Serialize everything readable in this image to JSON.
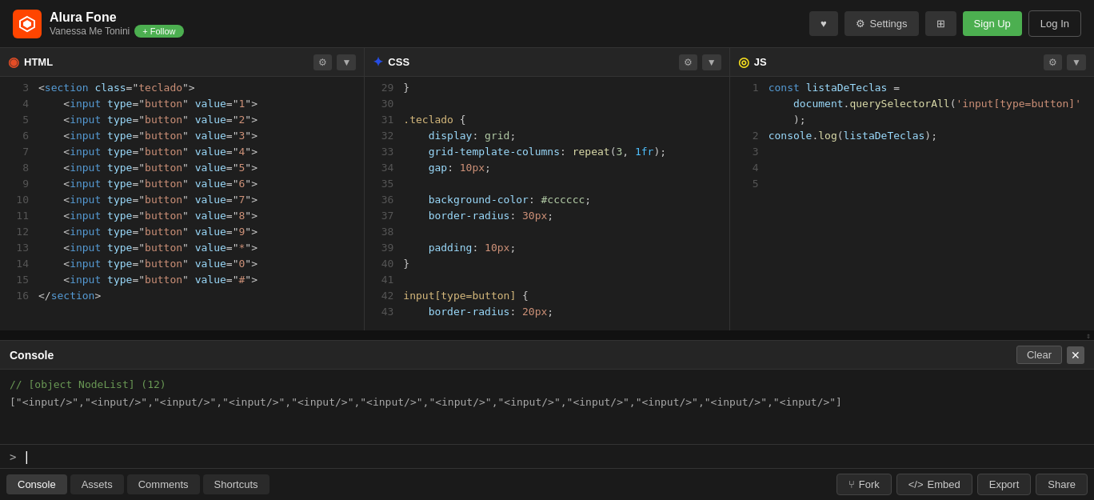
{
  "header": {
    "logo_symbol": "◈",
    "title": "Alura Fone",
    "subtitle": "Vanessa Me Tonini",
    "follow_label": "+ Follow",
    "heart_icon": "♥",
    "settings_icon": "⚙",
    "settings_label": "Settings",
    "grid_icon": "⊞",
    "signup_label": "Sign Up",
    "login_label": "Log In"
  },
  "editors": {
    "html": {
      "label": "HTML",
      "icon": "◉",
      "lines": [
        {
          "num": "3",
          "code": "<section class=\"teclado\">"
        },
        {
          "num": "4",
          "code": "    <input type=\"button\" value=\"1\">"
        },
        {
          "num": "5",
          "code": "    <input type=\"button\" value=\"2\">"
        },
        {
          "num": "6",
          "code": "    <input type=\"button\" value=\"3\">"
        },
        {
          "num": "7",
          "code": "    <input type=\"button\" value=\"4\">"
        },
        {
          "num": "8",
          "code": "    <input type=\"button\" value=\"5\">"
        },
        {
          "num": "9",
          "code": "    <input type=\"button\" value=\"6\">"
        },
        {
          "num": "10",
          "code": "    <input type=\"button\" value=\"7\">"
        },
        {
          "num": "11",
          "code": "    <input type=\"button\" value=\"8\">"
        },
        {
          "num": "12",
          "code": "    <input type=\"button\" value=\"9\">"
        },
        {
          "num": "13",
          "code": "    <input type=\"button\" value=\"*\">"
        },
        {
          "num": "14",
          "code": "    <input type=\"button\" value=\"0\">"
        },
        {
          "num": "15",
          "code": "    <input type=\"button\" value=\"#\">"
        },
        {
          "num": "16",
          "code": "</section>"
        }
      ]
    },
    "css": {
      "label": "CSS",
      "icon": "✦",
      "lines": [
        {
          "num": "29",
          "code": "}"
        },
        {
          "num": "30",
          "code": ""
        },
        {
          "num": "31",
          "code": ".teclado {"
        },
        {
          "num": "32",
          "code": "    display: grid;"
        },
        {
          "num": "33",
          "code": "    grid-template-columns: repeat(3, 1fr);"
        },
        {
          "num": "34",
          "code": "    gap: 10px;"
        },
        {
          "num": "35",
          "code": ""
        },
        {
          "num": "36",
          "code": "    background-color: #cccccc;"
        },
        {
          "num": "37",
          "code": "    border-radius: 30px;"
        },
        {
          "num": "38",
          "code": ""
        },
        {
          "num": "39",
          "code": "    padding: 10px;"
        },
        {
          "num": "40",
          "code": "}"
        },
        {
          "num": "41",
          "code": ""
        },
        {
          "num": "42",
          "code": "input[type=button] {"
        },
        {
          "num": "43",
          "code": "    border-radius: 20px;"
        }
      ]
    },
    "js": {
      "label": "JS",
      "icon": "◎",
      "lines": [
        {
          "num": "1",
          "code_parts": [
            {
              "text": "const ",
              "cls": "kw"
            },
            {
              "text": "listaDeTeclas",
              "cls": "prop"
            },
            {
              "text": " =",
              "cls": "punc"
            }
          ]
        },
        {
          "num": "",
          "code_parts": [
            {
              "text": "    document",
              "cls": "prop"
            },
            {
              "text": ".",
              "cls": "punc"
            },
            {
              "text": "querySelectorAll",
              "cls": "fn"
            },
            {
              "text": "('input[type=button]'",
              "cls": "str"
            }
          ]
        },
        {
          "num": "",
          "code_parts": [
            {
              "text": "    );",
              "cls": "punc"
            }
          ]
        },
        {
          "num": "2",
          "code_parts": [
            {
              "text": "console",
              "cls": "prop"
            },
            {
              "text": ".",
              "cls": "punc"
            },
            {
              "text": "log",
              "cls": "fn"
            },
            {
              "text": "(listaDeTeclas);",
              "cls": "punc"
            }
          ]
        },
        {
          "num": "3",
          "code_parts": []
        },
        {
          "num": "4",
          "code_parts": []
        },
        {
          "num": "5",
          "code_parts": []
        }
      ]
    }
  },
  "console": {
    "title": "Console",
    "clear_label": "Clear",
    "close_icon": "✕",
    "output": [
      "// [object NodeList] (12)",
      "[\"<input/>\",\"<input/>\",\"<input/>\",\"<input/>\",\"<input/>\",\"<input/>\",\"<input/>\",\"<input/>\",\"<input/>\",\"<input/>\",\"<input/>\",\"<input/>\"]"
    ],
    "prompt": ">"
  },
  "bottom_tabs": {
    "tabs": [
      {
        "label": "Console",
        "active": true
      },
      {
        "label": "Assets",
        "active": false
      },
      {
        "label": "Comments",
        "active": false
      },
      {
        "label": "Shortcuts",
        "active": false
      }
    ],
    "right_buttons": [
      {
        "label": "Fork",
        "icon": "⑂"
      },
      {
        "label": "Embed",
        "icon": "⟨⟩"
      },
      {
        "label": "Export",
        "icon": ""
      },
      {
        "label": "Share",
        "icon": ""
      }
    ]
  }
}
